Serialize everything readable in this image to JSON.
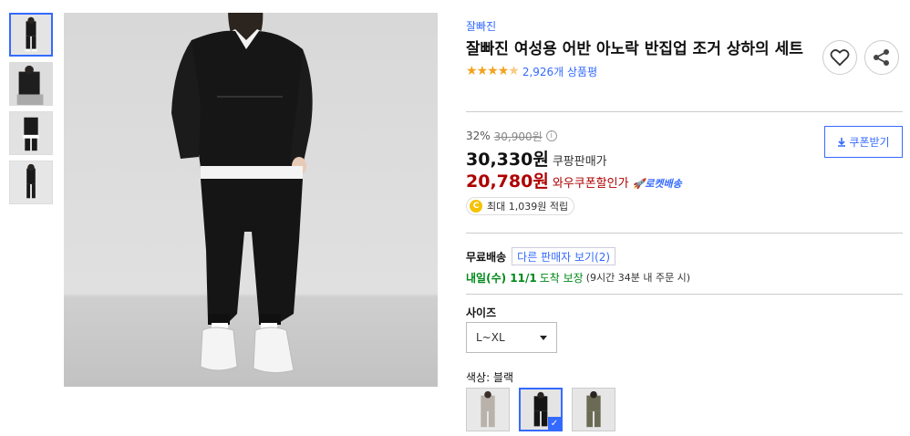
{
  "product": {
    "brand": "잘빠진",
    "title": "잘빠진 여성용 어반 아노락 반집업 조거 상하의 세트",
    "rating_stars": 4.5,
    "review_count": "2,926개 상품평"
  },
  "actions": {
    "wishlist_icon": "heart-icon",
    "share_icon": "share-icon"
  },
  "price": {
    "discount_rate": "32%",
    "original_price": "30,900원",
    "sale_price": "30,330원",
    "sale_label": "쿠팡판매가",
    "wow_price": "20,780원",
    "wow_label": "와우쿠폰할인가",
    "rocket_label": "로켓배송",
    "coupon_button": "쿠폰받기",
    "points_coin": "C",
    "points_text": "최대 1,039원 적립"
  },
  "shipping": {
    "free_label": "무료배송",
    "other_sellers": "다른 판매자 보기(2)",
    "arrival_strong": "내일(수) 11/1",
    "arrival_mid": "도착 보장",
    "arrival_note": "(9시간 34분 내 주문 시)"
  },
  "size": {
    "label": "사이즈",
    "selected": "L~XL"
  },
  "color": {
    "label_prefix": "색상:",
    "selected": "블랙",
    "options": [
      "gray",
      "black",
      "khaki"
    ],
    "selected_index": 1
  },
  "colors": {
    "accent": "#346aff",
    "wow": "#ae0000",
    "arrival": "#00891a",
    "star": "#f3a21d"
  }
}
